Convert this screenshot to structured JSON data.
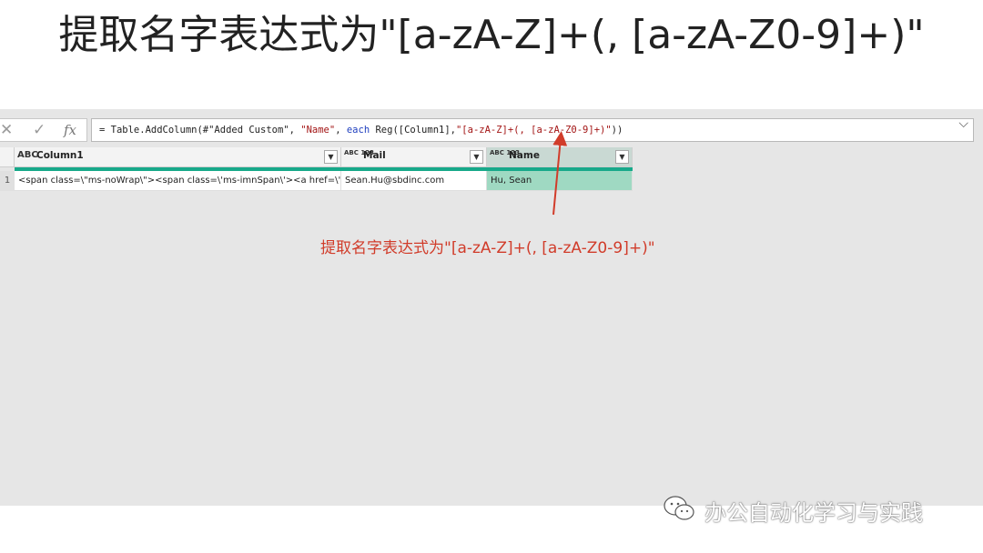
{
  "slide": {
    "title": "提取名字表达式为\"[a-zA-Z]+(, [a-zA-Z0-9]+)\""
  },
  "formula_bar": {
    "cancel_icon": "✕",
    "commit_icon": "✓",
    "fx_icon": "fx",
    "parts": {
      "p1": "= Table.AddColumn(#\"Added Custom\", ",
      "p2": "\"Name\"",
      "p3": ", ",
      "p4": "each",
      "p5": " Reg([Column1],",
      "p6": "\"[a-zA-Z]+(, [a-zA-Z0-9]+)\"",
      "p7": "))"
    },
    "dropdown_icon": "⌵"
  },
  "table": {
    "columns": [
      {
        "type_icon": "ABC",
        "label": "Column1"
      },
      {
        "type_icon": "ABC 123",
        "label": "Mail"
      },
      {
        "type_icon": "ABC 123",
        "label": "Name"
      }
    ],
    "rows": [
      {
        "row_number": "1",
        "column1": "<span class=\\\"ms-noWrap\\\"><span class=\\'ms-imnSpan\\'><a href=\\'#\\...",
        "mail": "Sean.Hu@sbdinc.com",
        "name": "Hu, Sean"
      }
    ]
  },
  "annotation": {
    "text": "提取名字表达式为\"[a-zA-Z]+(, [a-zA-Z0-9]+)\"",
    "color": "#d13c2a"
  },
  "watermark": {
    "text": "办公自动化学习与实践"
  },
  "colors": {
    "quality_bar": "#17a98a",
    "selected_column": "#9fd9c2",
    "background": "#e6e6e6"
  }
}
